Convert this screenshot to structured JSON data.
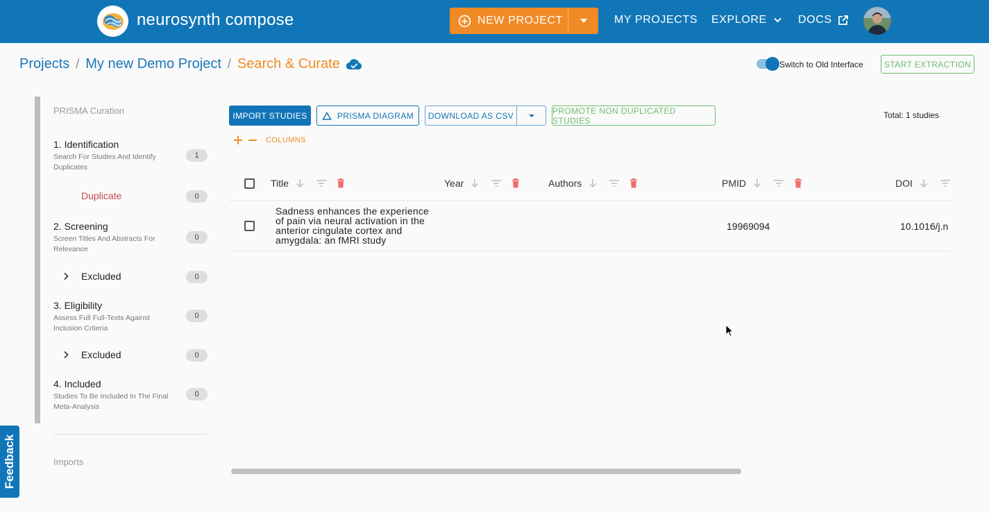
{
  "header": {
    "app_title": "neurosynth compose",
    "new_project_label": "NEW PROJECT",
    "nav": {
      "my_projects": "MY PROJECTS",
      "explore": "EXPLORE",
      "docs": "DOCS"
    }
  },
  "breadcrumb": {
    "projects": "Projects",
    "project_name": "My new Demo Project",
    "current": "Search & Curate"
  },
  "toggle_label": "Switch to Old Interface",
  "start_extraction_label": "START EXTRACTION",
  "sidebar": {
    "title": "PRISMA Curation",
    "steps": [
      {
        "name": "1. Identification",
        "desc": "Search For Studies And Identify Duplicates",
        "count": "1"
      },
      {
        "name": "2. Screening",
        "desc": "Screen Titles And Abstracts For Relevance",
        "count": "0"
      },
      {
        "name": "3. Eligibility",
        "desc": "Assess Full Full-Texts Against Inclusion Criteria",
        "count": "0"
      },
      {
        "name": "4. Included",
        "desc": "Studies To Be Included In The Final Meta-Analysis",
        "count": "0"
      }
    ],
    "duplicate": {
      "label": "Duplicate",
      "count": "0"
    },
    "screening_excluded": {
      "label": "Excluded",
      "count": "0"
    },
    "eligibility_excluded": {
      "label": "Excluded",
      "count": "0"
    },
    "imports_label": "Imports"
  },
  "toolbar": {
    "import_label": "IMPORT STUDIES",
    "prisma_label": "PRISMA DIAGRAM",
    "csv_label": "DOWNLOAD AS CSV",
    "promote_label": "PROMOTE NON DUPLICATED STUDIES",
    "total": "Total: 1 studies",
    "columns_label": "COLUMNS"
  },
  "table": {
    "columns": [
      "Title",
      "Year",
      "Authors",
      "PMID",
      "DOI"
    ],
    "rows": [
      {
        "title": "Sadness enhances the experience of pain via neural activation in the anterior cingulate cortex and amygdala: an fMRI study",
        "year": "",
        "authors": "",
        "pmid": "19969094",
        "doi": "10.1016/j.n"
      }
    ]
  },
  "feedback_label": "Feedback",
  "colors": {
    "primary": "#1176b8",
    "accent": "#f08a24",
    "success": "#6bbf6b",
    "danger": "#f26c6c"
  }
}
